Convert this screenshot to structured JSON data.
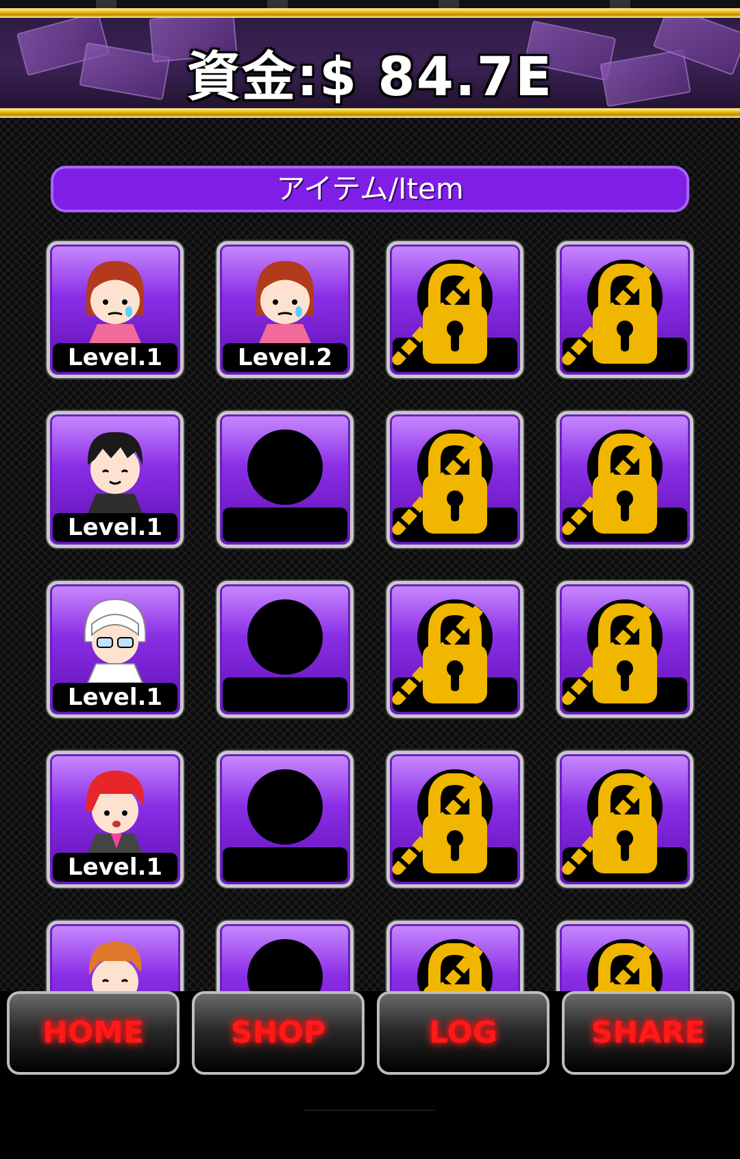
{
  "header": {
    "money_label": "資金:$ 84.7E"
  },
  "section": {
    "title": "アイテム/Item"
  },
  "tiles": [
    {
      "state": "unlocked",
      "level": "Level.1",
      "icon": "girl-crying-icon"
    },
    {
      "state": "unlocked",
      "level": "Level.2",
      "icon": "girl-crying-icon"
    },
    {
      "state": "locked",
      "level": "",
      "icon": "lock-icon"
    },
    {
      "state": "locked",
      "level": "",
      "icon": "lock-icon"
    },
    {
      "state": "unlocked",
      "level": "Level.1",
      "icon": "boy-smiling-icon"
    },
    {
      "state": "silhouette",
      "level": "",
      "icon": "silhouette-icon"
    },
    {
      "state": "locked",
      "level": "",
      "icon": "lock-icon"
    },
    {
      "state": "locked",
      "level": "",
      "icon": "lock-icon"
    },
    {
      "state": "unlocked",
      "level": "Level.1",
      "icon": "white-hair-glasses-icon"
    },
    {
      "state": "silhouette",
      "level": "",
      "icon": "silhouette-icon"
    },
    {
      "state": "locked",
      "level": "",
      "icon": "lock-icon"
    },
    {
      "state": "locked",
      "level": "",
      "icon": "lock-icon"
    },
    {
      "state": "unlocked",
      "level": "Level.1",
      "icon": "red-hair-icon"
    },
    {
      "state": "silhouette",
      "level": "",
      "icon": "silhouette-icon"
    },
    {
      "state": "locked",
      "level": "",
      "icon": "lock-icon"
    },
    {
      "state": "locked",
      "level": "",
      "icon": "lock-icon"
    },
    {
      "state": "unlocked",
      "level": "",
      "icon": "orange-hair-icon"
    },
    {
      "state": "silhouette",
      "level": "",
      "icon": "silhouette-icon"
    },
    {
      "state": "locked",
      "level": "",
      "icon": "lock-icon"
    },
    {
      "state": "locked",
      "level": "",
      "icon": "lock-icon"
    }
  ],
  "nav": {
    "home": "HOME",
    "shop": "SHOP",
    "log": "LOG",
    "share": "SHARE"
  },
  "colors": {
    "accent_purple": "#7f1fe5",
    "gold": "#f1c40f",
    "nav_text": "#ff1a1a"
  }
}
